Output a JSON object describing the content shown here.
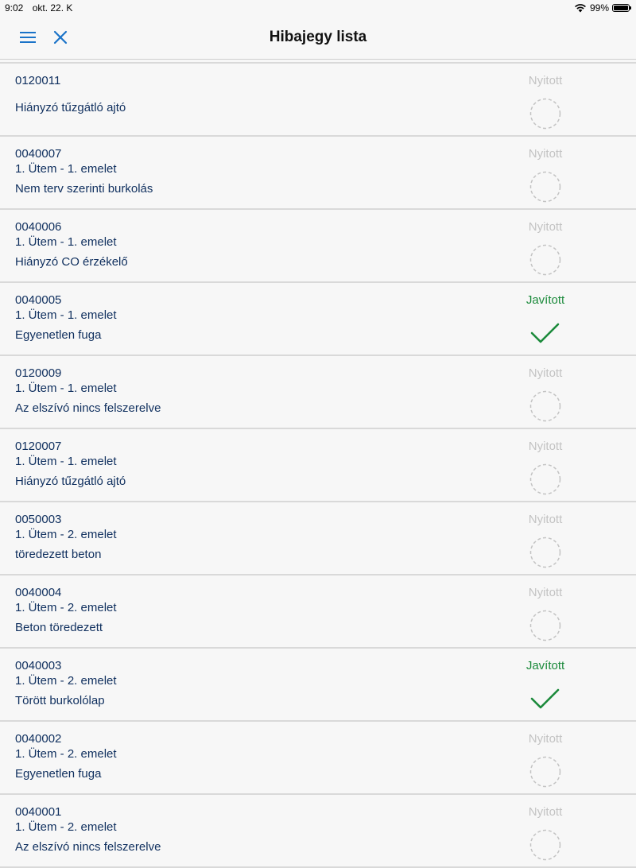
{
  "status_bar": {
    "time": "9:02",
    "date": "okt. 22. K",
    "battery": "99%"
  },
  "nav": {
    "title": "Hibajegy lista"
  },
  "colors": {
    "accent": "#1a73c8",
    "text": "#0f2f5e",
    "fixed": "#1b8a3b",
    "open": "#c3c3c3"
  },
  "tickets": [
    {
      "code": "0120011",
      "location": "",
      "description": "Hiányzó tűzgátló ajtó",
      "status": "Nyitott",
      "state": "open"
    },
    {
      "code": "0040007",
      "location": "1. Ütem - 1. emelet",
      "description": "Nem terv szerinti burkolás",
      "status": "Nyitott",
      "state": "open"
    },
    {
      "code": "0040006",
      "location": "1. Ütem - 1. emelet",
      "description": "Hiányzó CO érzékelő",
      "status": "Nyitott",
      "state": "open"
    },
    {
      "code": "0040005",
      "location": "1. Ütem - 1. emelet",
      "description": "Egyenetlen fuga",
      "status": "Javított",
      "state": "fixed"
    },
    {
      "code": "0120009",
      "location": "1. Ütem - 1. emelet",
      "description": "Az elszívó nincs felszerelve",
      "status": "Nyitott",
      "state": "open"
    },
    {
      "code": "0120007",
      "location": "1. Ütem - 1. emelet",
      "description": "Hiányzó tűzgátló ajtó",
      "status": "Nyitott",
      "state": "open"
    },
    {
      "code": "0050003",
      "location": "1. Ütem - 2. emelet",
      "description": "töredezett beton",
      "status": "Nyitott",
      "state": "open"
    },
    {
      "code": "0040004",
      "location": "1. Ütem - 2. emelet",
      "description": "Beton töredezett",
      "status": "Nyitott",
      "state": "open"
    },
    {
      "code": "0040003",
      "location": "1. Ütem - 2. emelet",
      "description": "Törött burkolólap",
      "status": "Javított",
      "state": "fixed"
    },
    {
      "code": "0040002",
      "location": "1. Ütem - 2. emelet",
      "description": "Egyenetlen fuga",
      "status": "Nyitott",
      "state": "open"
    },
    {
      "code": "0040001",
      "location": "1. Ütem - 2. emelet",
      "description": "Az elszívó nincs felszerelve",
      "status": "Nyitott",
      "state": "open"
    }
  ]
}
